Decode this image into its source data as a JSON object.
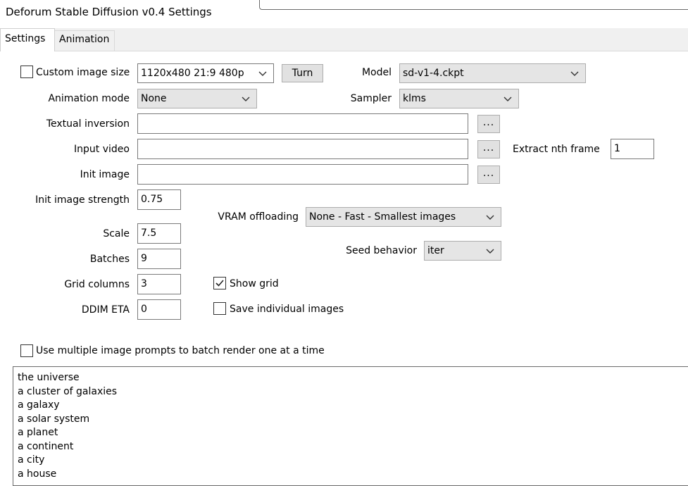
{
  "window": {
    "title": "Deforum Stable Diffusion v0.4 Settings"
  },
  "tabs": [
    "Settings",
    "Animation"
  ],
  "custom_image_size": {
    "label": "Custom image size",
    "checked": false,
    "value": "1120x480 21:9 480p"
  },
  "turn_button": "Turn",
  "model": {
    "label": "Model",
    "value": "sd-v1-4.ckpt"
  },
  "animation_mode": {
    "label": "Animation mode",
    "value": "None"
  },
  "sampler": {
    "label": "Sampler",
    "value": "klms"
  },
  "textual_inversion": {
    "label": "Textual inversion",
    "value": ""
  },
  "input_video": {
    "label": "Input video",
    "value": ""
  },
  "extract_nth_frame": {
    "label": "Extract nth frame",
    "value": "1"
  },
  "init_image": {
    "label": "Init image",
    "value": ""
  },
  "browse_label": "...",
  "init_image_strength": {
    "label": "Init image strength",
    "value": "0.75"
  },
  "vram_offloading": {
    "label": "VRAM offloading",
    "value": "None - Fast - Smallest images"
  },
  "scale": {
    "label": "Scale",
    "value": "7.5"
  },
  "batches": {
    "label": "Batches",
    "value": "9"
  },
  "seed_behavior": {
    "label": "Seed behavior",
    "value": "iter"
  },
  "grid_columns": {
    "label": "Grid columns",
    "value": "3"
  },
  "show_grid": {
    "label": "Show grid",
    "checked": true
  },
  "ddim_eta": {
    "label": "DDIM ETA",
    "value": "0"
  },
  "save_individual": {
    "label": "Save individual images",
    "checked": false
  },
  "multiple_prompts": {
    "label": "Use multiple image prompts to batch render one at a time",
    "checked": false
  },
  "prompts": [
    "the universe",
    "a cluster of galaxies",
    "a galaxy",
    "a solar system",
    "a planet",
    "a continent",
    "a city",
    "a house"
  ]
}
